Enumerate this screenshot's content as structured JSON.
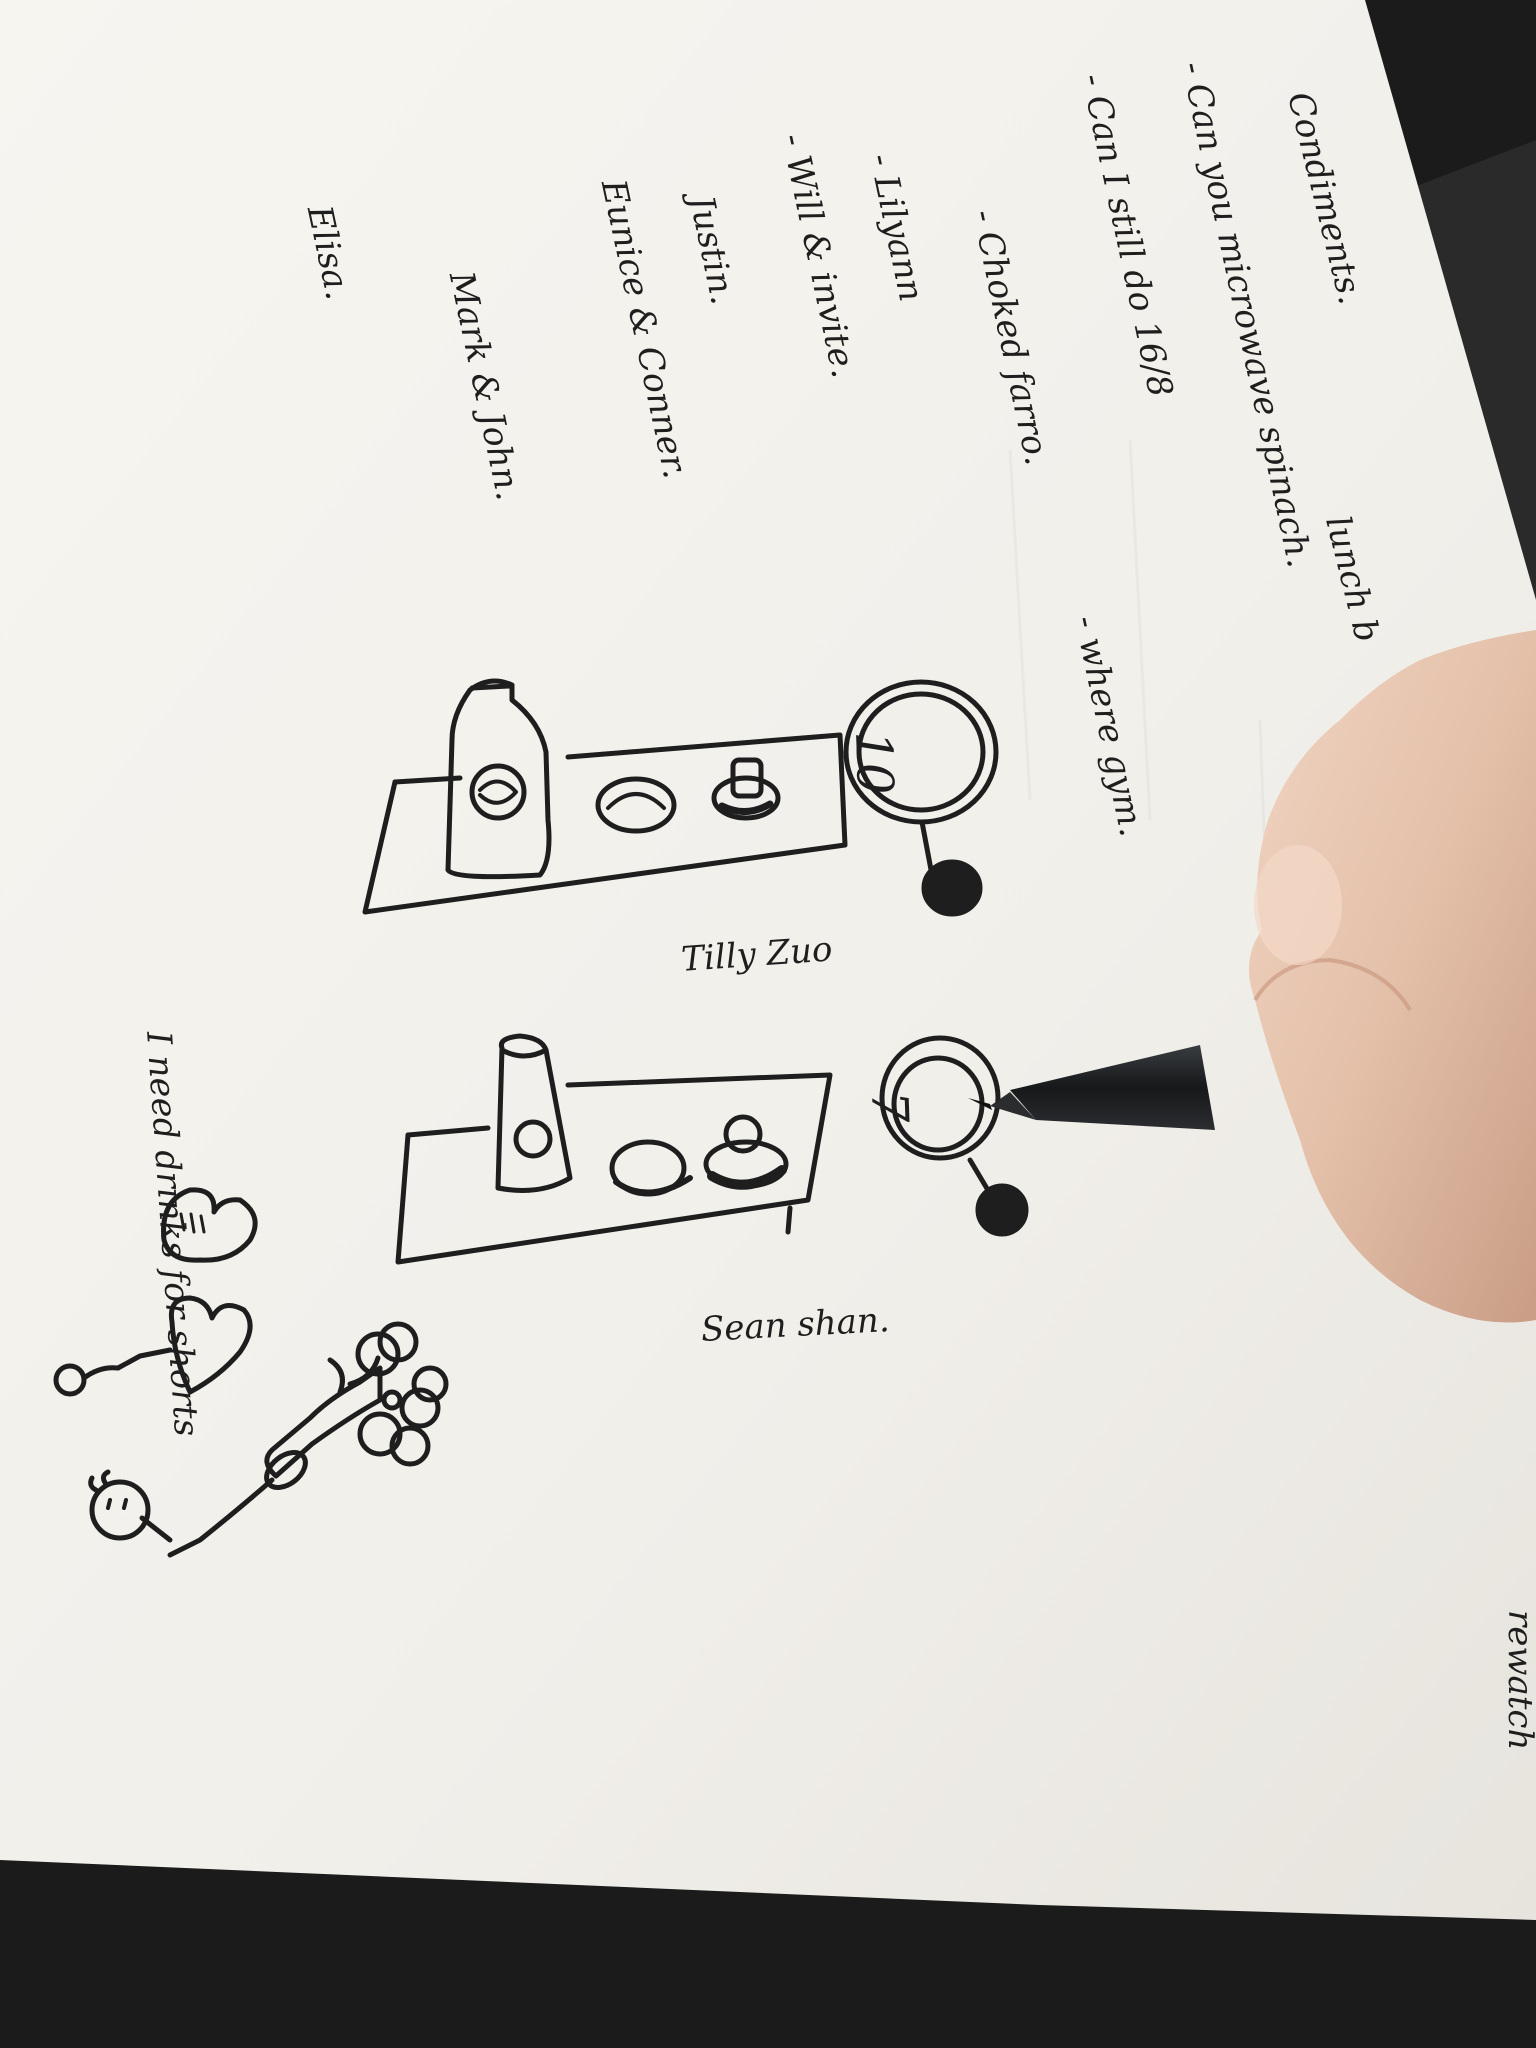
{
  "photo": {
    "colors": {
      "paper": "#f3f1ec",
      "paper_shadow": "#e2dfd8",
      "ink": "#1e1e1e",
      "desk": "#1c1c1c",
      "skin": "#e7c9b5",
      "pen": "#222426"
    }
  },
  "notes": {
    "lines": [
      "Condiments.",
      "lunch b",
      "- Can you microwave spinach.",
      "- Can I still do 16/8",
      "- where gym.",
      "- Choked farro.",
      "- Lilyann",
      "- Will & invite.",
      "Justin.",
      "Eunice & Conner.",
      "Mark & John.",
      "Elisa.",
      "I need drinks for shorts",
      "rewatch"
    ]
  },
  "sketches": [
    {
      "name": "Tilly Zuo",
      "badge": "10"
    },
    {
      "name": "Sean shan.",
      "badge": "7"
    }
  ]
}
